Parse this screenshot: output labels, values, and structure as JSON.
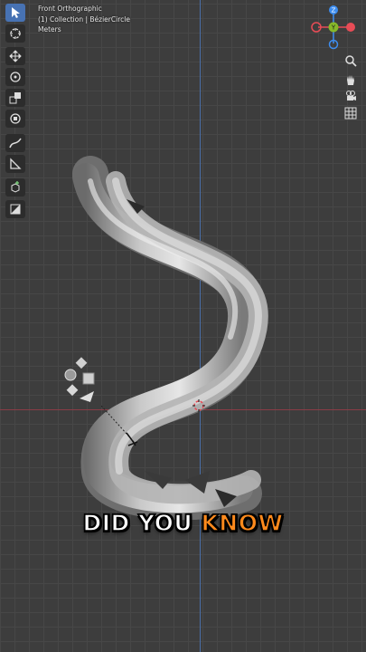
{
  "viewport": {
    "view_name": "Front Orthographic",
    "collection_line": "(1) Collection | BézierCircle",
    "units": "Meters",
    "axis_colors": {
      "x": "#8a3c46",
      "z": "#4a6fa8"
    }
  },
  "toolbar": {
    "tools": [
      {
        "icon": "select-cursor-icon",
        "active": true
      },
      {
        "icon": "cursor-3d-icon",
        "active": false
      },
      {
        "icon": "move-icon",
        "active": false
      },
      {
        "icon": "rotate-icon",
        "active": false
      },
      {
        "icon": "scale-icon",
        "active": false
      },
      {
        "icon": "transform-icon",
        "active": false
      },
      {
        "icon": "annotate-icon",
        "active": false
      },
      {
        "icon": "measure-icon",
        "active": false
      },
      {
        "icon": "add-cube-icon",
        "active": false
      },
      {
        "icon": "extrude-icon",
        "active": false
      }
    ]
  },
  "gizmo": {
    "z_label": "Z",
    "y_label": "Y",
    "x_label": "X",
    "colors": {
      "x": "#e84c56",
      "y": "#86b829",
      "z": "#3d8df0"
    }
  },
  "nav_buttons": [
    "zoom-icon",
    "pan-hand-icon",
    "camera-icon",
    "grid-icon"
  ],
  "caption": {
    "word1": "DID YOU",
    "word2": "KNOW",
    "highlight_color": "#ff8a1c"
  }
}
